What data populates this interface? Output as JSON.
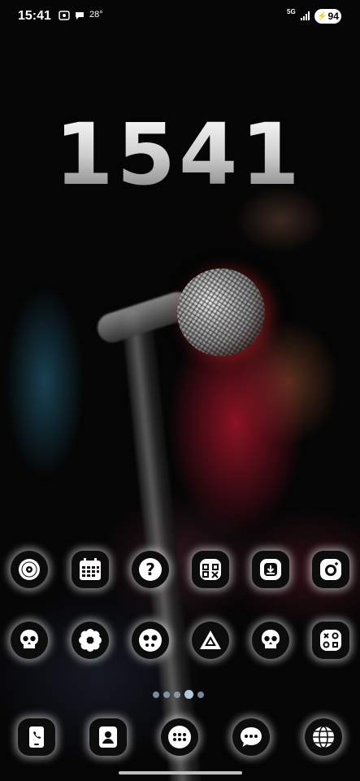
{
  "status_bar": {
    "time": "15:41",
    "temperature": "28°",
    "network": "5G",
    "battery": "94",
    "icons": [
      "screen-record-icon",
      "chat-icon",
      "signal-icon",
      "battery-charging-icon"
    ]
  },
  "clock_widget": {
    "time_digits": "1541"
  },
  "app_rows": [
    [
      "vinyl-record-icon",
      "calendar-icon",
      "help-question-icon",
      "compass-grid-icon",
      "download-icon",
      "camera-icon"
    ],
    [
      "skull-icon",
      "flower-icon",
      "skull-face-icon",
      "drive-triangle-icon",
      "skull-icon",
      "games-icon"
    ]
  ],
  "dock": [
    "phone-icon",
    "contacts-icon",
    "app-drawer-icon",
    "messages-icon",
    "browser-icon"
  ],
  "page_indicator": {
    "count": 5,
    "active_index": 3
  },
  "colors": {
    "icon_glow": "#ffffff",
    "icon_bg": "#0c0c0c",
    "indicator": "#9fb3c8"
  }
}
